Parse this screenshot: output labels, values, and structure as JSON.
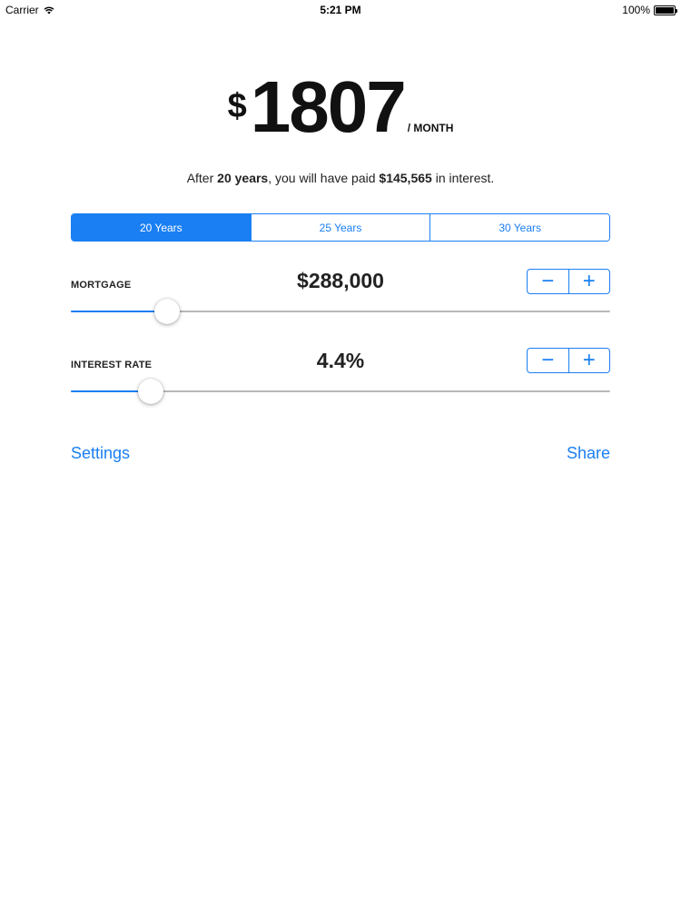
{
  "status_bar": {
    "carrier": "Carrier",
    "time": "5:21 PM",
    "battery": "100%",
    "battery_level": 1.0
  },
  "payment": {
    "currency": "$",
    "amount": "1807",
    "period": "/ MONTH"
  },
  "summary": {
    "prefix": "After ",
    "years": "20 years",
    "middle": ", you will have paid ",
    "interest": "$145,565",
    "suffix": " in interest."
  },
  "term_tabs": [
    {
      "label": "20 Years",
      "selected": true
    },
    {
      "label": "25 Years",
      "selected": false
    },
    {
      "label": "30 Years",
      "selected": false
    }
  ],
  "mortgage": {
    "label": "MORTGAGE",
    "value": "$288,000",
    "slider_fraction": 0.178,
    "minus": "−",
    "plus": "+"
  },
  "interest_rate": {
    "label": "INTEREST RATE",
    "value": "4.4%",
    "slider_fraction": 0.148,
    "minus": "−",
    "plus": "+"
  },
  "footer": {
    "settings": "Settings",
    "share": "Share"
  },
  "colors": {
    "accent": "#1a7ff3",
    "track": "#b8b8b8",
    "text": "#111111"
  }
}
